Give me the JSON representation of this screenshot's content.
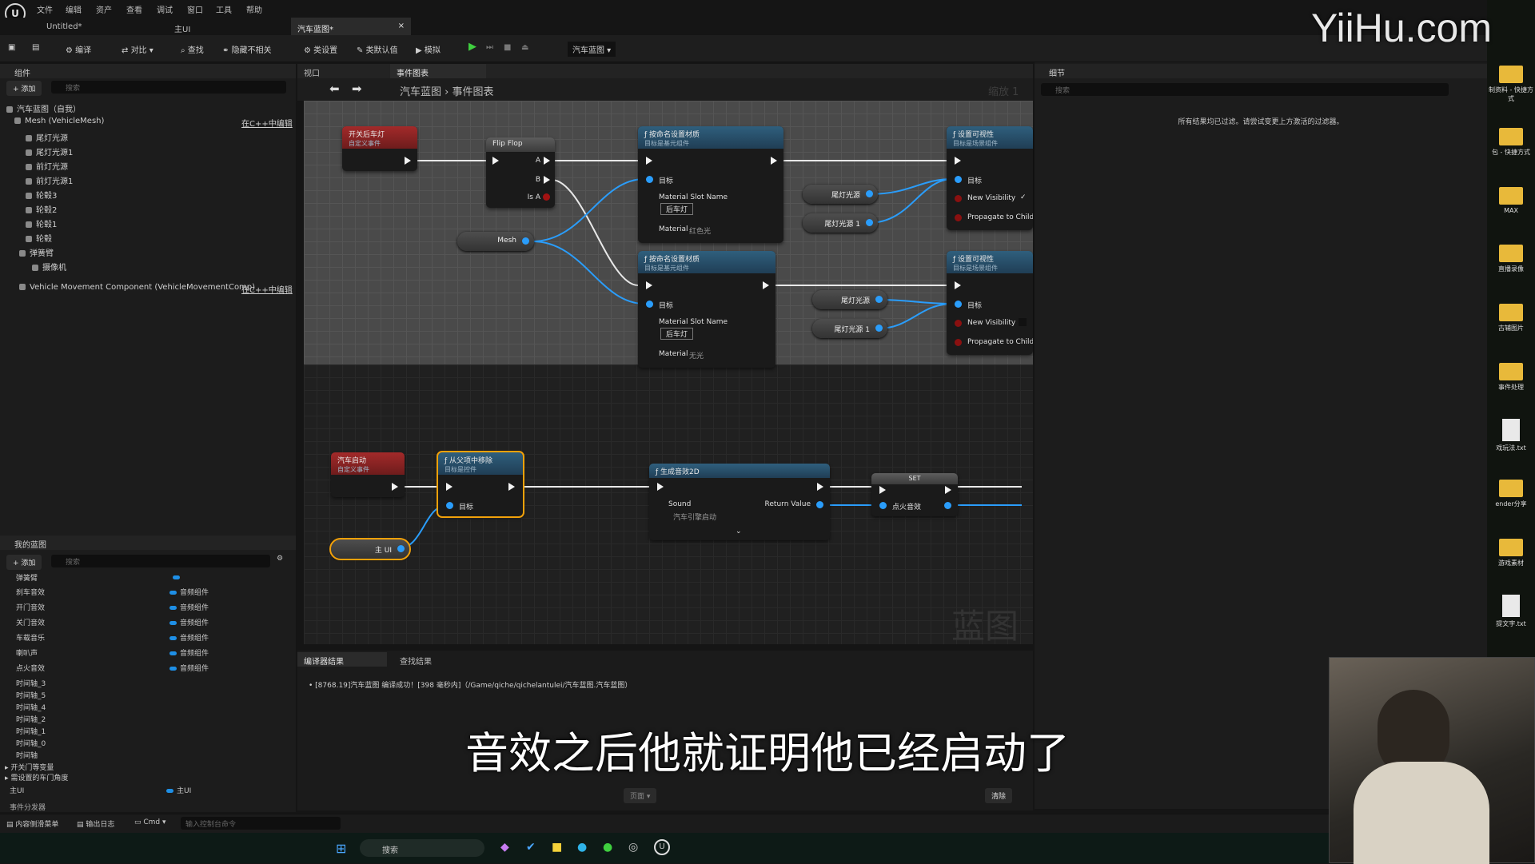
{
  "menu": [
    "文件",
    "编辑",
    "资产",
    "查看",
    "调试",
    "窗口",
    "工具",
    "帮助"
  ],
  "tabs": [
    {
      "label": "Untitled*"
    },
    {
      "label": "主UI"
    },
    {
      "label": "汽车蓝图*"
    }
  ],
  "toolbar": {
    "compile": "编译",
    "diff": "对比",
    "find": "查找",
    "hide_unrelated": "隐藏不相关",
    "class_settings": "类设置",
    "class_defaults": "类默认值",
    "simulate": "模拟",
    "debug_target": "汽车蓝图"
  },
  "components": {
    "title": "组件",
    "add": "添加",
    "search_placeholder": "搜索",
    "root": "汽车蓝图（自我）",
    "mesh": "Mesh (VehicleMesh)",
    "edit_cpp": "在C++中编辑",
    "items": [
      "尾灯光源",
      "尾灯光源1",
      "前灯光源",
      "前灯光源1",
      "轮毂3",
      "轮毂2",
      "轮毂1",
      "轮毂",
      "弹簧臂",
      "摄像机"
    ],
    "movement": "Vehicle Movement Component (VehicleMovementComp)",
    "edit_cpp2": "在C++中编辑"
  },
  "my_blueprint": {
    "title": "我的蓝图",
    "add": "添加",
    "search_placeholder": "搜索",
    "top": "弹簧臂",
    "vars": [
      {
        "name": "刹车音效",
        "type": "音频组件"
      },
      {
        "name": "开门音效",
        "type": "音频组件"
      },
      {
        "name": "关门音效",
        "type": "音频组件"
      },
      {
        "name": "车载音乐",
        "type": "音频组件"
      },
      {
        "name": "喇叭声",
        "type": "音频组件"
      },
      {
        "name": "点火音效",
        "type": "音频组件"
      }
    ],
    "timelines": [
      "时间轴_3",
      "时间轴_5",
      "时间轴_4",
      "时间轴_2",
      "时间轴_1",
      "时间轴_0",
      "时间轴"
    ],
    "groups": [
      "开关门等变量",
      "需设置的车门角度"
    ],
    "main_ui": {
      "name": "主UI",
      "type": "主UI"
    },
    "dispatchers": "事件分发器"
  },
  "center": {
    "viewport_tab": "视口",
    "event_graph_tab": "事件图表",
    "breadcrumb_root": "汽车蓝图",
    "breadcrumb_leaf": "事件图表",
    "zoom": "缩放 1",
    "watermark": "蓝图"
  },
  "nodes": {
    "toggle_lights": {
      "title": "开关后车灯",
      "sub": "自定义事件"
    },
    "flipflop": {
      "title": "Flip Flop",
      "a": "A",
      "b": "B",
      "isa": "Is A"
    },
    "mesh": "Mesh",
    "set_mat1": {
      "title": "按命名设置材质",
      "sub": "目标是基元组件",
      "target": "目标",
      "slot": "Material Slot Name",
      "slot_val": "后车灯",
      "material": "Material",
      "mat_val": "红色光"
    },
    "set_mat2": {
      "title": "按命名设置材质",
      "sub": "目标是基元组件",
      "target": "目标",
      "slot": "Material Slot Name",
      "slot_val": "后车灯",
      "material": "Material",
      "mat_val": "无光"
    },
    "tail1": "尾灯光源",
    "tail2": "尾灯光源 1",
    "tail3": "尾灯光源",
    "tail4": "尾灯光源 1",
    "vis1": {
      "title": "设置可视性",
      "sub": "目标是场景组件",
      "target": "目标",
      "newvis": "New Visibility",
      "prop": "Propagate to Childre"
    },
    "vis2": {
      "title": "设置可视性",
      "sub": "目标是场景组件",
      "target": "目标",
      "newvis": "New Visibility",
      "prop": "Propagate to Childre"
    },
    "car_start": {
      "title": "汽车启动",
      "sub": "自定义事件"
    },
    "remove": {
      "title": "从父项中移除",
      "sub": "目标是控件",
      "target": "目标"
    },
    "main_ui": "主 UI",
    "sound2d": {
      "title": "生成音效2D",
      "sound": "Sound",
      "sound_val": "汽车引擎启动",
      "ret": "Return Value"
    },
    "set": {
      "title": "SET",
      "var": "点火音效"
    }
  },
  "details": {
    "title": "细节",
    "search_placeholder": "搜索",
    "empty_msg": "所有结果均已过滤。请尝试变更上方激活的过滤器。"
  },
  "output": {
    "compiler_tab": "编译器结果",
    "find_tab": "查找结果",
    "log": "[8768.19]汽车蓝图 编译成功！[398 毫秒内]（/Game/qiche/qichelantulei/汽车蓝图.汽车蓝图）",
    "page": "页面",
    "clear": "清除"
  },
  "bottombar": {
    "drawer": "内容侧滑菜单",
    "log": "输出日志",
    "cmd": "Cmd",
    "console_placeholder": "输入控制台命令"
  },
  "taskbar": {
    "search": "搜索"
  },
  "desktop": [
    "制资料 - 快捷方式",
    "包 - 快捷方式",
    "MAX",
    "直播录像",
    "古辅图片",
    "事件处理",
    "戏玩法.txt",
    "ender分享",
    "游戏素材",
    "提文字.txt"
  ],
  "watermark": "YiiHu.com",
  "subtitle": "音效之后他就证明他已经启动了"
}
